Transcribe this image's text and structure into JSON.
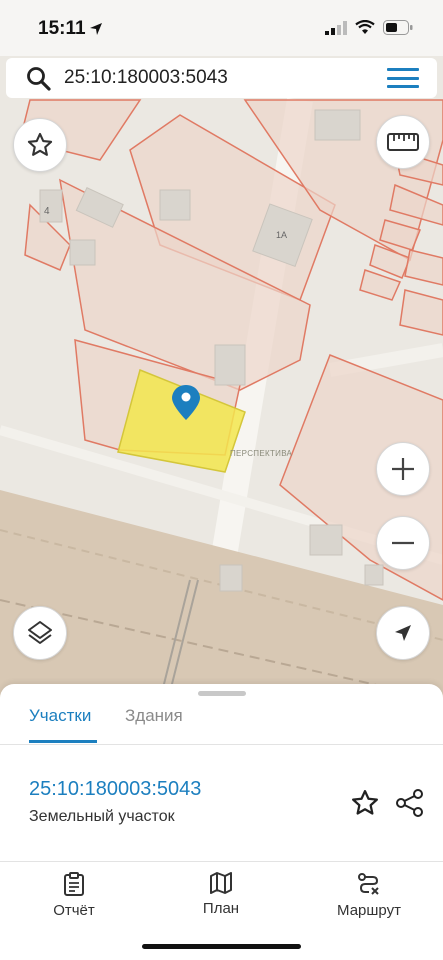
{
  "status": {
    "time": "15:11"
  },
  "search": {
    "value": "25:10:180003:5043"
  },
  "map": {
    "watermark": "ПЕРСПЕКТИВА",
    "labels": {
      "building_4": "4",
      "building_1a": "1А"
    },
    "parcel_color": "#f3e64e",
    "boundary_color": "#e07a64",
    "pin_color": "#1c7fbf"
  },
  "sheet": {
    "tabs": [
      {
        "label": "Участки",
        "active": true
      },
      {
        "label": "Здания",
        "active": false
      }
    ],
    "result": {
      "cadastral_number": "25:10:180003:5043",
      "type": "Земельный участок"
    }
  },
  "bottom_nav": {
    "items": [
      {
        "label": "Отчёт",
        "icon": "report-icon"
      },
      {
        "label": "План",
        "icon": "map-plan-icon"
      },
      {
        "label": "Маршрут",
        "icon": "route-icon"
      }
    ]
  },
  "colors": {
    "accent": "#1c7fbf"
  }
}
